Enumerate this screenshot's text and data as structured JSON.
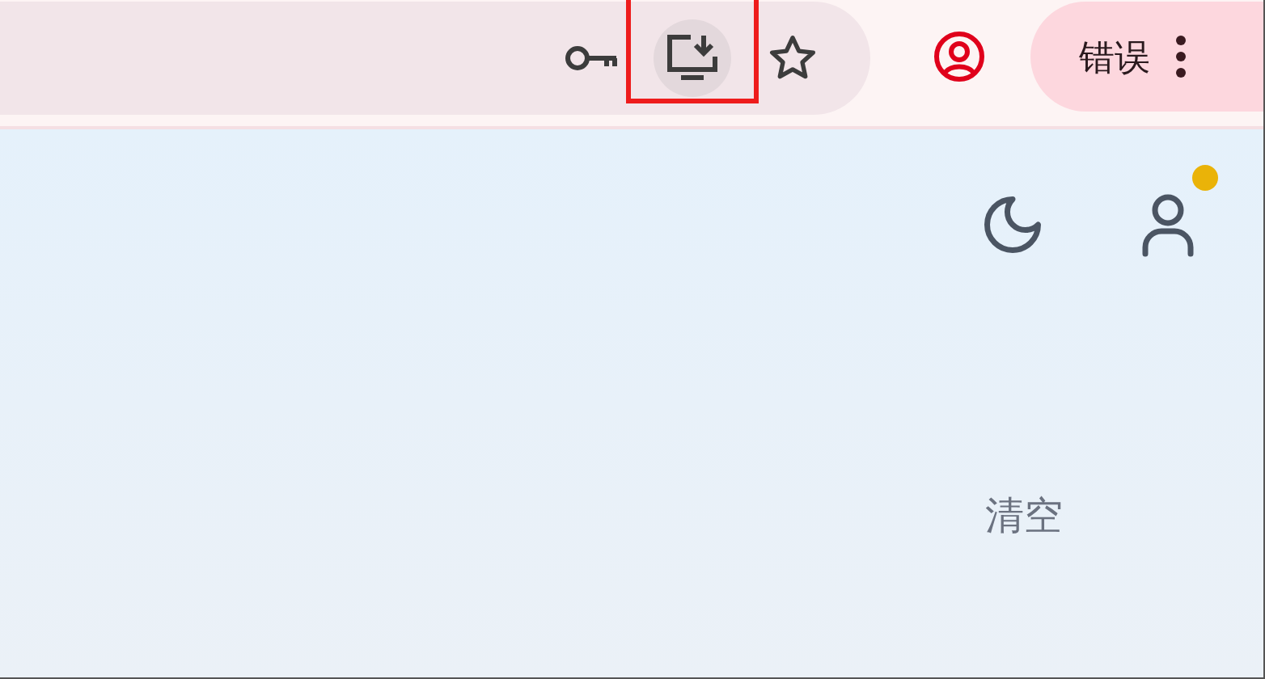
{
  "address_bar_icons": [
    {
      "kind": "key",
      "hovered": false,
      "highlighted": false
    },
    {
      "kind": "install",
      "hovered": true,
      "highlighted": true
    },
    {
      "kind": "star",
      "hovered": false,
      "highlighted": false
    }
  ],
  "error_button": {
    "label": "错误"
  },
  "page": {
    "account": {
      "notification": true
    },
    "clear_button": {
      "label": "清空"
    }
  }
}
